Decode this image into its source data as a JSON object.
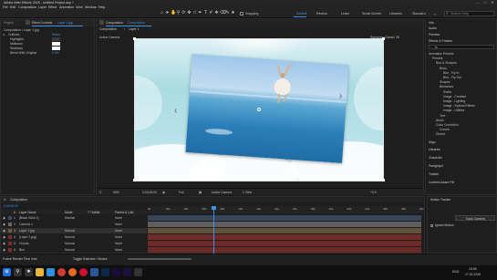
{
  "window": {
    "title": "Adobe After Effects 2025 - Untitled Project.aep *",
    "min": "–",
    "max": "□",
    "close": "✕"
  },
  "menu": [
    "File",
    "Edit",
    "Composition",
    "Layer",
    "Effect",
    "Animation",
    "View",
    "Window",
    "Help"
  ],
  "toolbar": {
    "tools": [
      "home-icon",
      "selection-icon",
      "hand-icon",
      "zoom-icon",
      "orbit-icon",
      "pan-icon",
      "dolly-icon",
      "rectangle-icon",
      "pen-icon",
      "text-icon",
      "brush-icon",
      "clone-icon",
      "eraser-icon",
      "roto-icon",
      "puppet-icon"
    ],
    "snapping": "Snapping",
    "workspaces": [
      "Default",
      "Review",
      "Learn",
      "Small Screen",
      "Libraries",
      "Standard"
    ],
    "active_workspace": "Default",
    "search_placeholder": "Search Help"
  },
  "left_panel": {
    "tab1": "Project",
    "tab2": "Effect Controls",
    "tab2_target": "Layer 1.jpg",
    "breadcrumb": "Composition • Layer 1.jpg",
    "effect_name": "Outlines",
    "reset": "Reset",
    "props": [
      {
        "label": "Highlights",
        "value": ""
      },
      {
        "label": "Midtones",
        "value": ""
      },
      {
        "label": "Shadows",
        "value": ""
      },
      {
        "label": "Blend With Original",
        "value": "0.0%"
      }
    ]
  },
  "composition": {
    "tab": "Composition",
    "tab_name": "Composition",
    "subtabs": [
      "Composition",
      "Footage",
      "Layer"
    ],
    "breadcrumb": [
      "Composition",
      "Layer 1"
    ],
    "active_camera": "Active Camera",
    "renderer": "Renderer: Classic 3D"
  },
  "viewer_controls": {
    "zoom": "50%",
    "timecode": "0;00;05;00",
    "resolution": "Full",
    "view": "Active Camera",
    "views": "1 View",
    "exposure": "+0.0"
  },
  "right_panel": {
    "tabs": [
      "Info",
      "Audio",
      "Preview",
      "Effects & Presets"
    ],
    "search_value": "fx",
    "tree": [
      "Animation Presets",
      "Presets",
      "Blur & Sharpen",
      "Blurs",
      "Blur - Fly In",
      "Blur - Fly Out",
      "Shapes",
      "Behaviors",
      "Swirls",
      "Image - Creative",
      "Image - Lighting",
      "Image - Special Effects",
      "Image - Utilities",
      "Text",
      "Audio",
      "Color Correction",
      "Curves",
      "Distort"
    ],
    "sections": [
      "Align",
      "Libraries",
      "Character",
      "Paragraph",
      "Tracker",
      "Content-Aware Fill"
    ]
  },
  "timeline": {
    "tab": "Composition",
    "timecode": "0;00;05;00",
    "columns": [
      "#",
      "Layer Name",
      "Mode",
      "T TrkMat",
      "Parent & Link"
    ],
    "ruler": [
      "0s",
      "02s",
      "04s",
      "06s",
      "08s",
      "10s",
      "12s",
      "14s",
      "16s",
      "18s",
      "20s",
      "22s",
      "24s",
      "26s",
      "28s",
      "30s"
    ],
    "layers": [
      {
        "index": "1",
        "name": "[Black Solid 1]",
        "mode": "Normal",
        "parent": "None",
        "color": "#3b4d63"
      },
      {
        "index": "2",
        "name": "Camera 1",
        "mode": "",
        "parent": "None",
        "color": "#6a6a6a"
      },
      {
        "index": "3",
        "name": "Layer 1.jpg",
        "mode": "Normal",
        "parent": "None",
        "color": "#6b5c3f"
      },
      {
        "index": "4",
        "name": "[Layer 2.jpg]",
        "mode": "Normal",
        "parent": "None",
        "color": "#7c2c2c"
      },
      {
        "index": "5",
        "name": "Clouds",
        "mode": "Normal",
        "parent": "None",
        "color": "#7c2c2c"
      },
      {
        "index": "6",
        "name": "Blur",
        "mode": "Normal",
        "parent": "None",
        "color": "#7c2c2c"
      }
    ],
    "toggle": "Toggle Switches / Modes",
    "frame_render": "Frame Render Time 0ms"
  },
  "motion_panel": {
    "title": "Motion Tracker",
    "track_btn": "Track Camera",
    "reset": "Reset",
    "ignore": "Ignore Motion"
  },
  "taskbar": {
    "icons": [
      "windows-icon",
      "search-icon",
      "task-view-icon",
      "explorer-icon",
      "edge-icon",
      "chrome-icon",
      "firefox-icon",
      "opera-icon",
      "word-icon",
      "photoshop-icon",
      "premiere-icon",
      "after-effects-icon",
      "media-icon"
    ],
    "lang": "ENG",
    "time": "19:06",
    "date": "17.02.2025"
  }
}
